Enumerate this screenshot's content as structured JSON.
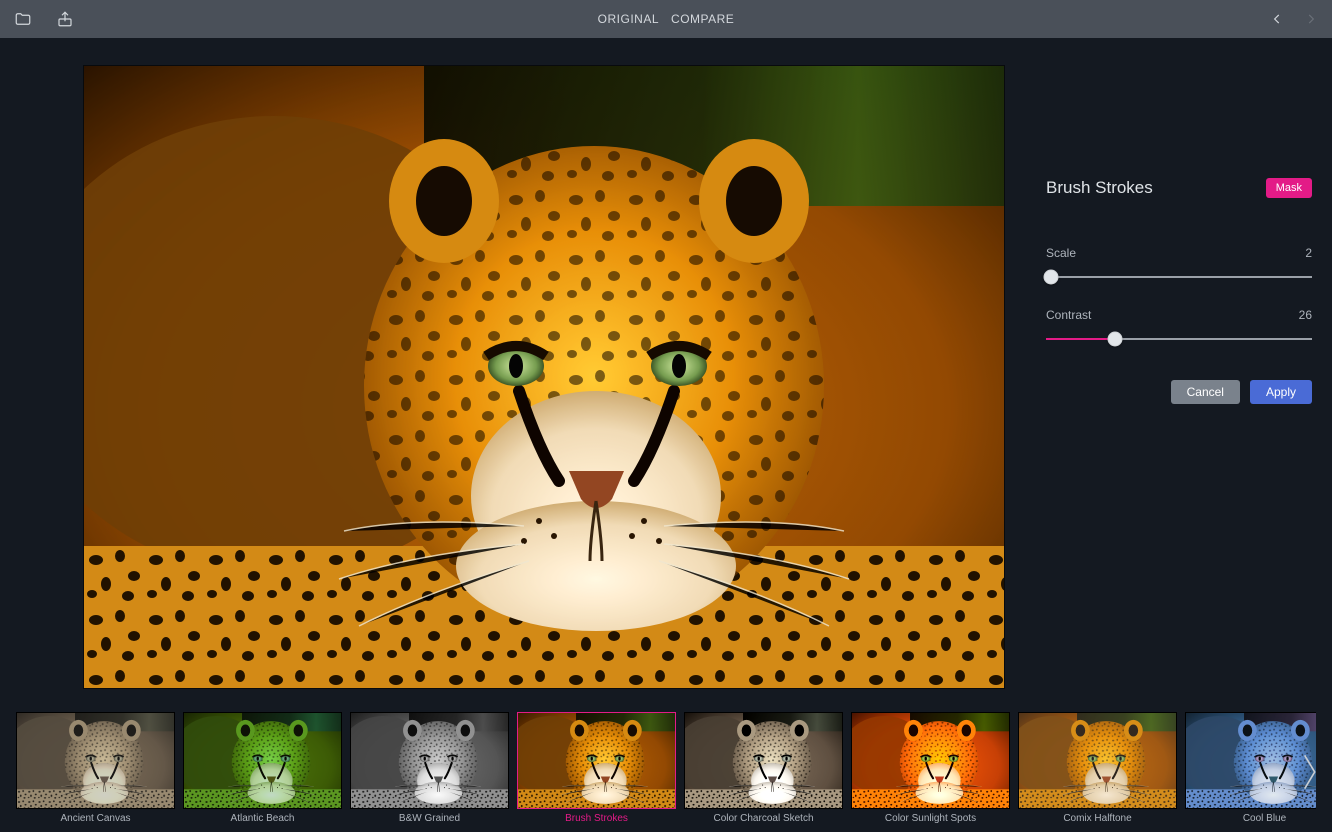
{
  "topbar": {
    "original_label": "ORIGINAL",
    "compare_label": "COMPARE"
  },
  "panel": {
    "title": "Brush Strokes",
    "mask_label": "Mask",
    "sliders": [
      {
        "label": "Scale",
        "value": 2,
        "min": 0,
        "max": 100,
        "pct": 2
      },
      {
        "label": "Contrast",
        "value": 26,
        "min": 0,
        "max": 100,
        "pct": 26
      }
    ],
    "cancel_label": "Cancel",
    "apply_label": "Apply"
  },
  "filmstrip": {
    "selected_index": 3,
    "items": [
      {
        "label": "Ancient Canvas",
        "filter": "f-ancient"
      },
      {
        "label": "Atlantic Beach",
        "filter": "f-atlantic"
      },
      {
        "label": "B&W Grained",
        "filter": "f-bw"
      },
      {
        "label": "Brush Strokes",
        "filter": "f-brush"
      },
      {
        "label": "Color Charcoal Sketch",
        "filter": "f-charcoal"
      },
      {
        "label": "Color Sunlight Spots",
        "filter": "f-sunlight"
      },
      {
        "label": "Comix Halftone",
        "filter": "f-comix"
      },
      {
        "label": "Cool Blue",
        "filter": "f-coolblue"
      }
    ]
  },
  "colors": {
    "accent": "#e31b87",
    "apply": "#4a6bd6",
    "cancel": "#7a828c"
  }
}
